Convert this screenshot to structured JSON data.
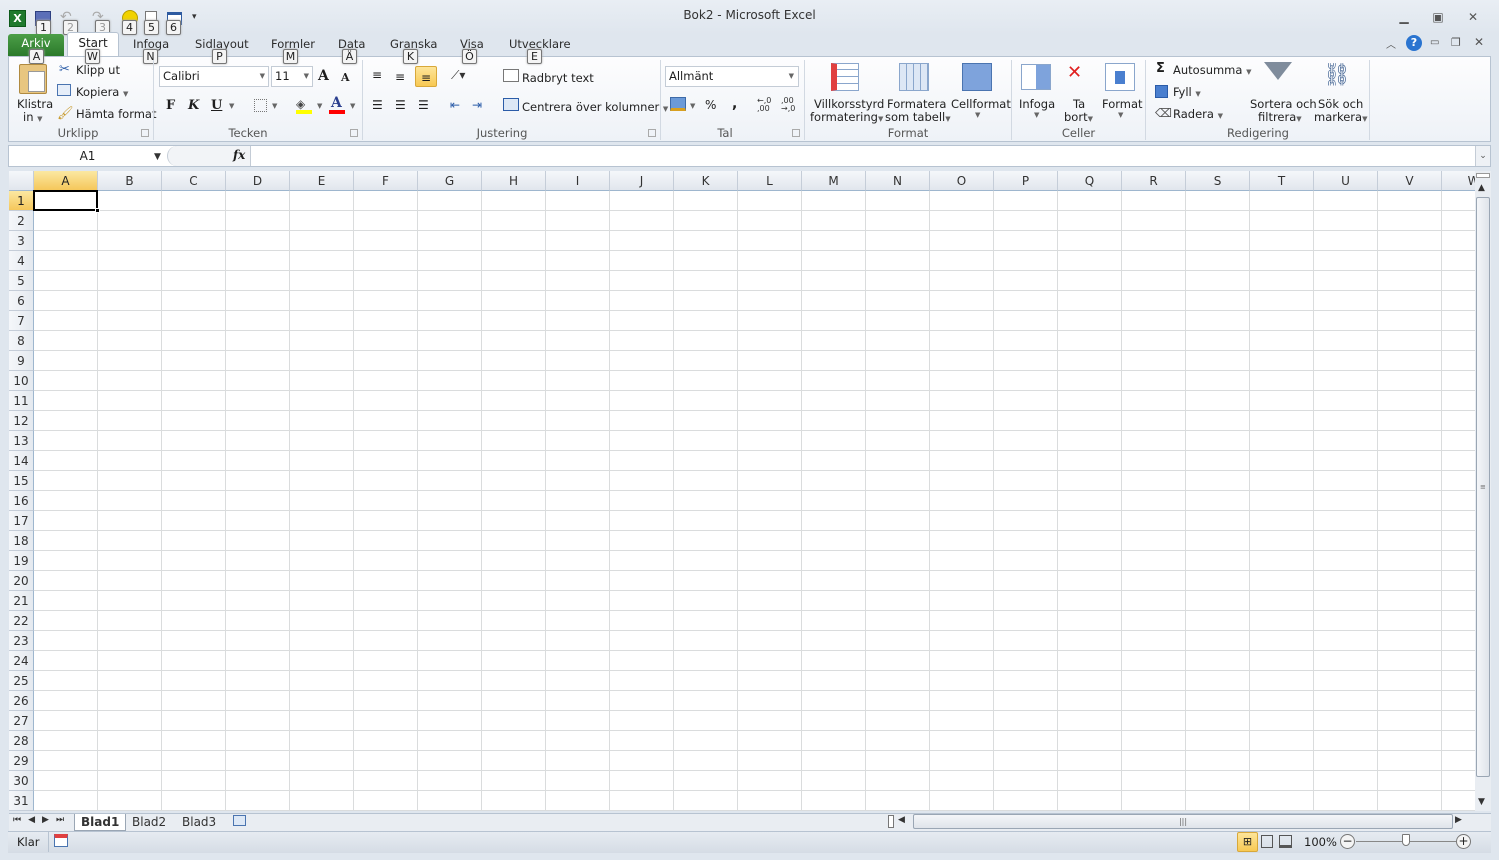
{
  "window": {
    "title": "Bok2  -  Microsoft Excel"
  },
  "quick_access": {
    "items": [
      {
        "name": "save",
        "key": "1"
      },
      {
        "name": "undo",
        "key": "2"
      },
      {
        "name": "redo",
        "key": "3"
      },
      {
        "name": "smiley",
        "key": "4"
      },
      {
        "name": "print-preview",
        "key": "5"
      },
      {
        "name": "form",
        "key": "6"
      }
    ]
  },
  "tabs": [
    {
      "label": "Arkiv",
      "key": "A"
    },
    {
      "label": "Start",
      "key": "W"
    },
    {
      "label": "Infoga",
      "key": "N"
    },
    {
      "label": "Sidlayout",
      "key": "P"
    },
    {
      "label": "Formler",
      "key": "M"
    },
    {
      "label": "Data",
      "key": "Ä"
    },
    {
      "label": "Granska",
      "key": "K"
    },
    {
      "label": "Visa",
      "key": "Ö"
    },
    {
      "label": "Utvecklare",
      "key": "E"
    }
  ],
  "ribbon": {
    "clipboard": {
      "label": "Urklipp",
      "paste_line1": "Klistra",
      "paste_line2": "in",
      "cut": "Klipp ut",
      "copy": "Kopiera",
      "format_painter": "Hämta format"
    },
    "font": {
      "label": "Tecken",
      "font_name": "Calibri",
      "font_size": "11",
      "bold": "F",
      "italic": "K",
      "underline": "U",
      "grow": "A",
      "shrink": "A",
      "font_color_letter": "A",
      "fill_color": "#ffff00",
      "font_color": "#ff0000"
    },
    "alignment": {
      "label": "Justering",
      "wrap_text": "Radbryt text",
      "merge_center": "Centrera över kolumner"
    },
    "number": {
      "label": "Tal",
      "format": "Allmänt",
      "percent": "%",
      "comma": ","
    },
    "styles": {
      "label": "Format",
      "conditional_line1": "Villkorsstyrd",
      "conditional_line2": "formatering",
      "as_table_line1": "Formatera",
      "as_table_line2": "som tabell",
      "cell_styles": "Cellformat"
    },
    "cells": {
      "label": "Celler",
      "insert": "Infoga",
      "delete_line1": "Ta",
      "delete_line2": "bort",
      "format": "Format"
    },
    "editing": {
      "label": "Redigering",
      "autosum": "Autosumma",
      "fill": "Fyll",
      "clear": "Radera",
      "sort_line1": "Sortera och",
      "sort_line2": "filtrera",
      "find_line1": "Sök och",
      "find_line2": "markera"
    }
  },
  "formula_bar": {
    "name_box": "A1",
    "fx": "fx",
    "formula": ""
  },
  "grid": {
    "columns": [
      "A",
      "B",
      "C",
      "D",
      "E",
      "F",
      "G",
      "H",
      "I",
      "J",
      "K",
      "L",
      "M",
      "N",
      "O",
      "P",
      "Q",
      "R",
      "S",
      "T",
      "U",
      "V",
      "W"
    ],
    "rows": [
      "1",
      "2",
      "3",
      "4",
      "5",
      "6",
      "7",
      "8",
      "9",
      "10",
      "11",
      "12",
      "13",
      "14",
      "15",
      "16",
      "17",
      "18",
      "19",
      "20",
      "21",
      "22",
      "23",
      "24",
      "25",
      "26",
      "27",
      "28",
      "29",
      "30",
      "31"
    ],
    "active_cell": "A1"
  },
  "sheets": {
    "tabs": [
      "Blad1",
      "Blad2",
      "Blad3"
    ],
    "active": "Blad1"
  },
  "status": {
    "mode": "Klar",
    "zoom": "100%",
    "zoom_level_percent": 100
  }
}
